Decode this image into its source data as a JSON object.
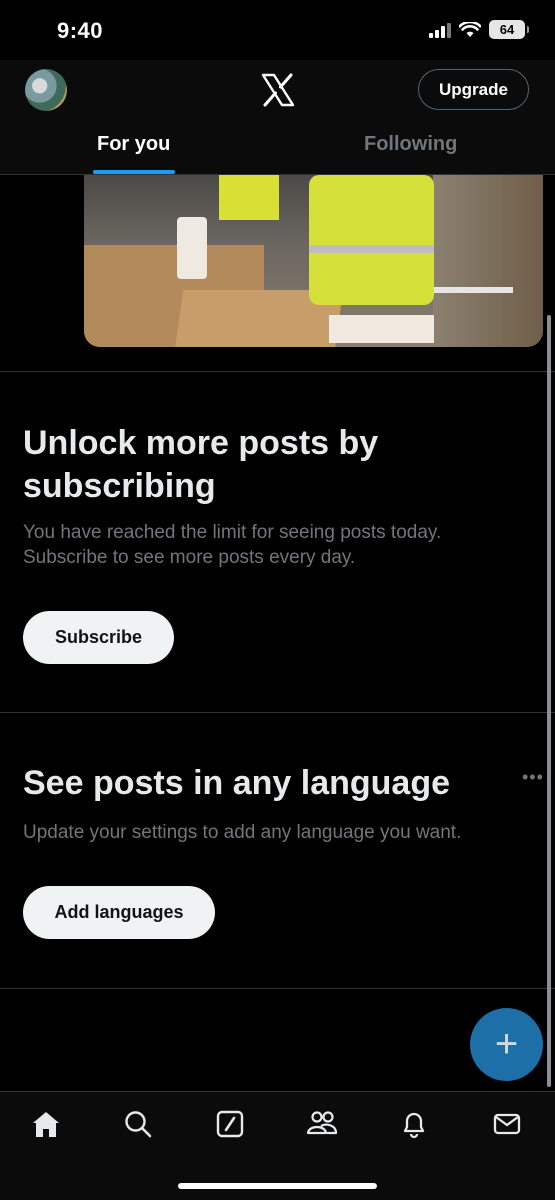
{
  "status_bar": {
    "time": "9:40",
    "battery": "64",
    "icons": [
      "signal-icon",
      "wifi-icon",
      "battery-icon"
    ]
  },
  "header": {
    "logo": "X",
    "upgrade_label": "Upgrade",
    "tabs": [
      {
        "label": "For you",
        "active": true
      },
      {
        "label": "Following",
        "active": false
      }
    ]
  },
  "promos": [
    {
      "title": "Unlock more posts by subscribing",
      "description": "You have reached the limit for seeing posts today. Subscribe to see more posts every day.",
      "button_label": "Subscribe"
    },
    {
      "title": "See posts in any language",
      "description": "Update your settings to add any language you want.",
      "button_label": "Add languages",
      "more_icon": "more-icon"
    }
  ],
  "fab": {
    "label": "+",
    "icon": "compose-plus-icon"
  },
  "bottom_nav": {
    "items": [
      "home-icon",
      "search-icon",
      "grok-icon",
      "communities-icon",
      "notifications-icon",
      "messages-icon"
    ],
    "active": "home-icon"
  },
  "colors": {
    "accent": "#1d9bf0",
    "fab": "#1d6fa8",
    "muted_text": "#71767b",
    "button_bg": "#eff3f4",
    "divider": "#2f3336"
  }
}
